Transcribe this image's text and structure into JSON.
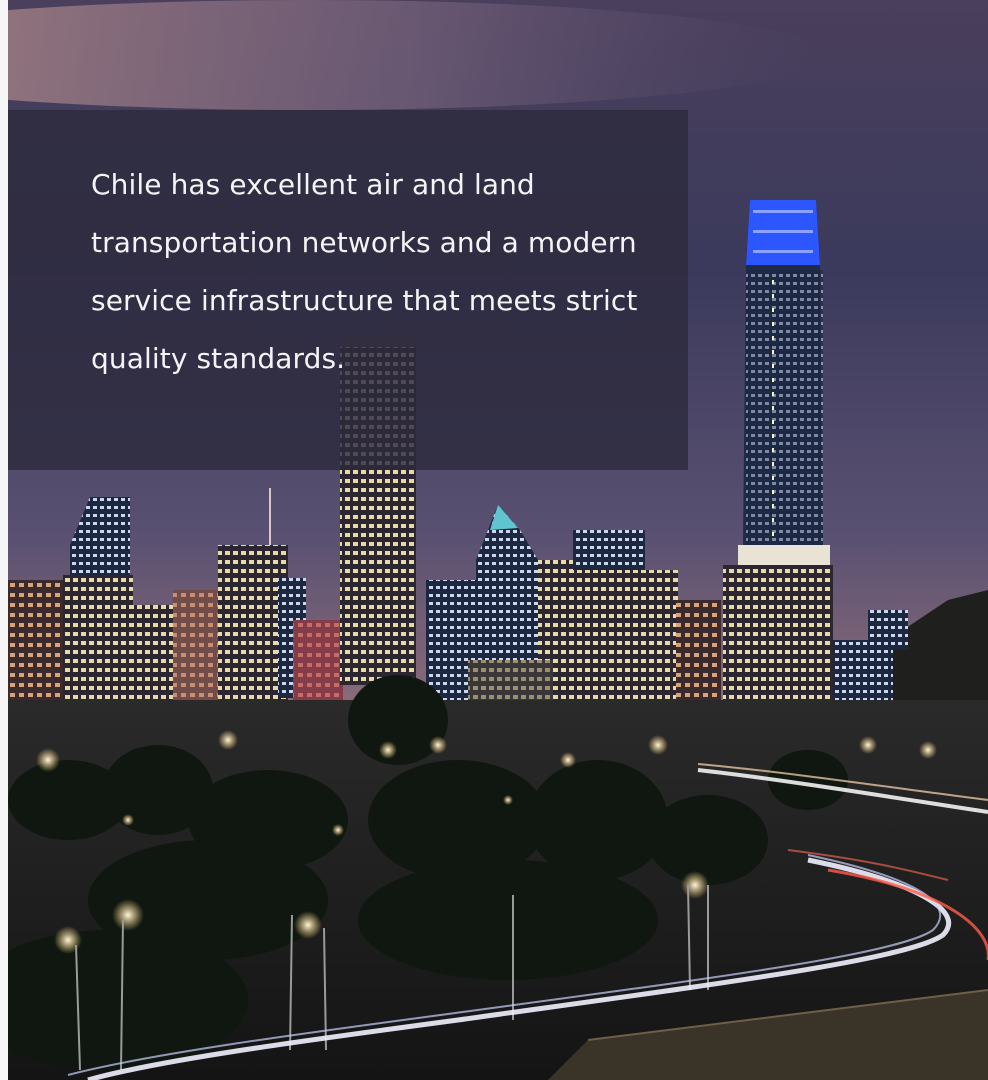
{
  "caption": {
    "text": "Chile has excellent air and land transportation networks and a modern service infrastructure that meets strict quality standards."
  },
  "scene": {
    "subject": "night-city-skyline",
    "colors": {
      "sky_top": "#3a3657",
      "sky_bottom": "#7a6276",
      "panel": "#2d2b3e",
      "tower_crown": "#2e56ff",
      "caption_text": "#f4f4f6"
    }
  }
}
